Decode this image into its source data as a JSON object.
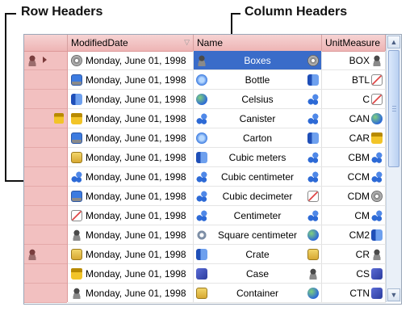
{
  "callouts": {
    "row_headers": "Row Headers",
    "column_headers": "Column Headers"
  },
  "columns": [
    {
      "label": "ModifiedDate",
      "filter_icon": "filter-icon"
    },
    {
      "label": "Name"
    },
    {
      "label": "UnitMeasure"
    }
  ],
  "rows": [
    {
      "date": "Monday, June 01, 1998",
      "name": "Boxes",
      "um": "BOX",
      "date_icon": "disk",
      "name_icon": "user",
      "name_icon_r": "disk",
      "um_icon": "user",
      "rh": [
        "user",
        "arrow"
      ],
      "selected": true
    },
    {
      "date": "Monday, June 01, 1998",
      "name": "Bottle",
      "um": "BTL",
      "date_icon": "monitor",
      "name_icon": "web",
      "name_icon_r": "book",
      "um_icon": "chart",
      "rh": []
    },
    {
      "date": "Monday, June 01, 1998",
      "name": "Celsius",
      "um": "C",
      "date_icon": "book",
      "name_icon": "globe",
      "name_icon_r": "network",
      "um_icon": "chart",
      "rh": []
    },
    {
      "date": "Monday, June 01, 1998",
      "name": "Canister",
      "um": "CAN",
      "date_icon": "lock",
      "name_icon": "network",
      "name_icon_r": "network",
      "um_icon": "globe",
      "rh": [
        "lock"
      ]
    },
    {
      "date": "Monday, June 01, 1998",
      "name": "Carton",
      "um": "CAR",
      "date_icon": "monitor",
      "name_icon": "web",
      "name_icon_r": "book",
      "um_icon": "lock",
      "rh": []
    },
    {
      "date": "Monday, June 01, 1998",
      "name": "Cubic meters",
      "um": "CBM",
      "date_icon": "mail",
      "name_icon": "book",
      "name_icon_r": "network",
      "um_icon": "network",
      "rh": []
    },
    {
      "date": "Monday, June 01, 1998",
      "name": "Cubic centimeter",
      "um": "CCM",
      "date_icon": "network",
      "name_icon": "network",
      "name_icon_r": "network",
      "um_icon": "network",
      "rh": []
    },
    {
      "date": "Monday, June 01, 1998",
      "name": "Cubic decimeter",
      "um": "CDM",
      "date_icon": "monitor",
      "name_icon": "network",
      "name_icon_r": "chart",
      "um_icon": "disk",
      "rh": []
    },
    {
      "date": "Monday, June 01, 1998",
      "name": "Centimeter",
      "um": "CM",
      "date_icon": "chart",
      "name_icon": "network",
      "name_icon_r": "network",
      "um_icon": "network",
      "rh": []
    },
    {
      "date": "Monday, June 01, 1998",
      "name": "Square centimeter",
      "um": "CM2",
      "date_icon": "user",
      "name_icon": "gear",
      "name_icon_r": "globe",
      "um_icon": "book",
      "rh": []
    },
    {
      "date": "Monday, June 01, 1998",
      "name": "Crate",
      "um": "CR",
      "date_icon": "mail",
      "name_icon": "book",
      "name_icon_r": "mail",
      "um_icon": "user",
      "rh": [
        "user"
      ]
    },
    {
      "date": "Monday, June 01, 1998",
      "name": "Case",
      "um": "CS",
      "date_icon": "lock",
      "name_icon": "puzzle",
      "name_icon_r": "user",
      "um_icon": "puzzle",
      "rh": []
    },
    {
      "date": "Monday, June 01, 1998",
      "name": "Container",
      "um": "CTN",
      "date_icon": "user",
      "name_icon": "mail",
      "name_icon_r": "globe",
      "um_icon": "puzzle",
      "rh": []
    }
  ],
  "colors": {
    "header_bg": "#eeb5b5",
    "rowheader_bg": "#f2c0c0",
    "selection": "#3a6cc9"
  }
}
